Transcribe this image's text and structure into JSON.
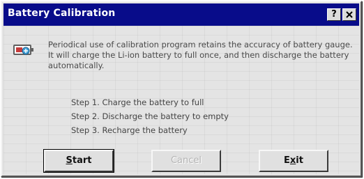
{
  "window": {
    "title": "Battery Calibration",
    "help_label": "?"
  },
  "description": "Periodical use of calibration program retains the accuracy of battery gauge. It will charge the Li-ion battery to full once, and then discharge the battery automatically.",
  "steps": [
    "Step 1. Charge the battery to full",
    "Step 2. Discharge the battery to empty",
    "Step 3. Recharge the battery"
  ],
  "buttons": {
    "start": {
      "mnemonic": "S",
      "rest": "tart"
    },
    "cancel": "Cancel",
    "exit": {
      "head": "E",
      "mnemonic": "x",
      "rest": "it"
    }
  },
  "colors": {
    "titlebar": "#080c8a",
    "window_bg": "#e3e3e3"
  }
}
